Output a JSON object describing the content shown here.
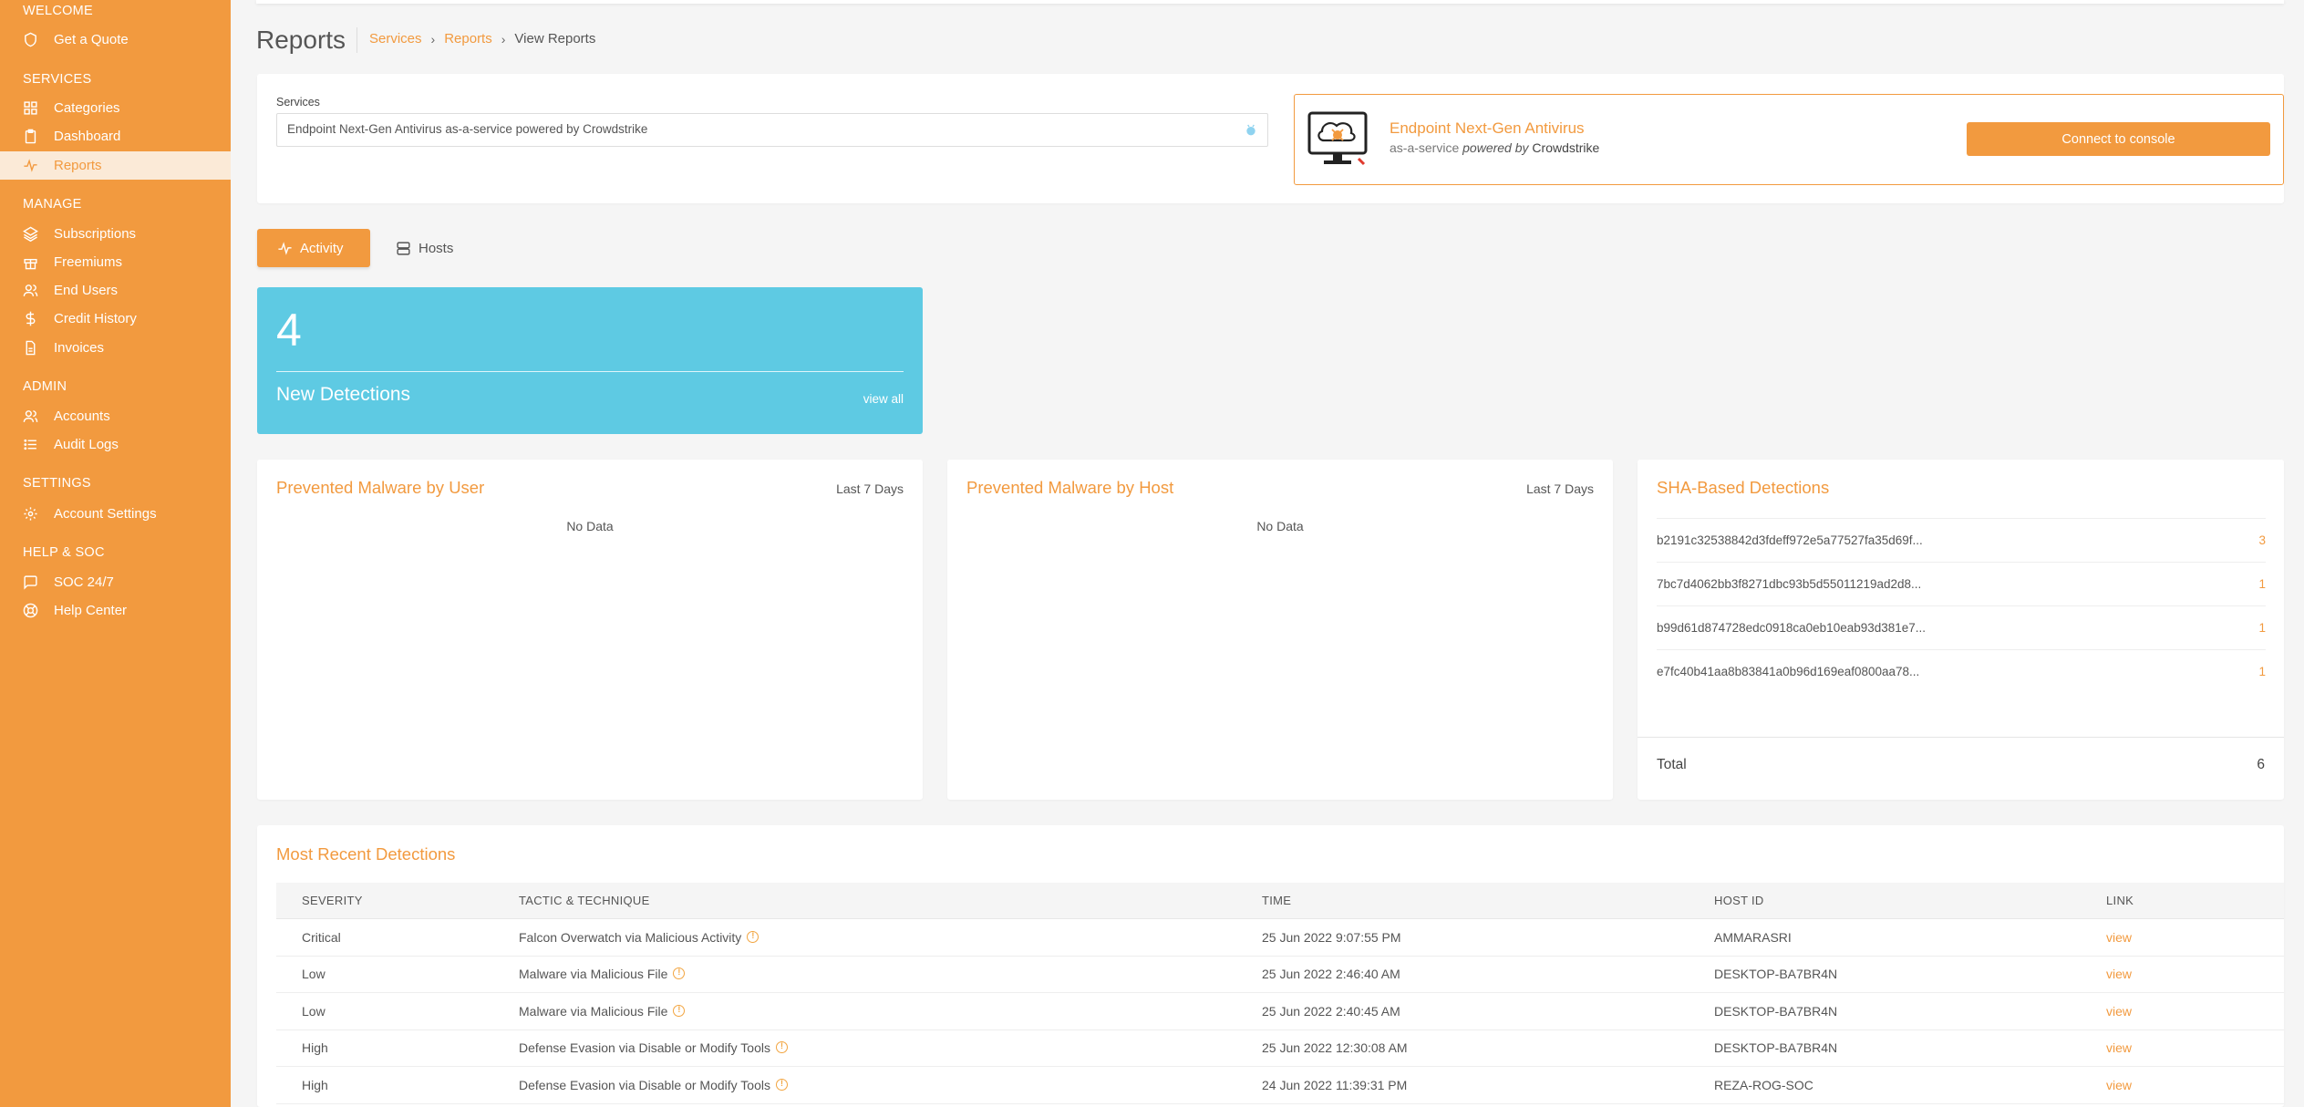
{
  "sidebar": {
    "sections": {
      "welcome": "WELCOME",
      "services": "SERVICES",
      "manage": "MANAGE",
      "admin": "ADMIN",
      "settings": "SETTINGS",
      "help": "HELP & SOC"
    },
    "items": {
      "get_quote": "Get a Quote",
      "categories": "Categories",
      "dashboard": "Dashboard",
      "reports": "Reports",
      "subscriptions": "Subscriptions",
      "freemiums": "Freemiums",
      "end_users": "End Users",
      "credit_history": "Credit History",
      "invoices": "Invoices",
      "accounts": "Accounts",
      "audit_logs": "Audit Logs",
      "account_settings": "Account Settings",
      "soc": "SOC 24/7",
      "help_center": "Help Center"
    }
  },
  "header": {
    "title": "Reports",
    "breadcrumb": [
      "Services",
      "Reports",
      "View Reports"
    ]
  },
  "services": {
    "label": "Services",
    "selected": "Endpoint Next-Gen Antivirus as-a-service powered by Crowdstrike"
  },
  "product": {
    "title": "Endpoint Next-Gen Antivirus",
    "sub_prefix": "as-a-service",
    "sub_powered": "powered by",
    "sub_vendor": "Crowdstrike",
    "connect_label": "Connect to console"
  },
  "tabs": {
    "activity": "Activity",
    "hosts": "Hosts"
  },
  "detections": {
    "count": "4",
    "label": "New Detections",
    "link": "view all"
  },
  "malware_user": {
    "title": "Prevented Malware by User",
    "range": "Last 7 Days",
    "empty": "No Data"
  },
  "malware_host": {
    "title": "Prevented Malware by Host",
    "range": "Last 7 Days",
    "empty": "No Data"
  },
  "sha": {
    "title": "SHA-Based Detections",
    "rows": [
      {
        "hash": "b2191c32538842d3fdeff972e5a77527fa35d69f...",
        "count": "3"
      },
      {
        "hash": "7bc7d4062bb3f8271dbc93b5d55011219ad2d8...",
        "count": "1"
      },
      {
        "hash": "b99d61d874728edc0918ca0eb10eab93d381e7...",
        "count": "1"
      },
      {
        "hash": "e7fc40b41aa8b83841a0b96d169eaf0800aa78...",
        "count": "1"
      }
    ],
    "total_label": "Total",
    "total_value": "6"
  },
  "recent": {
    "title": "Most Recent Detections",
    "columns": [
      "SEVERITY",
      "TACTIC & TECHNIQUE",
      "TIME",
      "HOST ID",
      "LINK"
    ],
    "rows": [
      {
        "severity": "Critical",
        "tactic": "Falcon Overwatch via Malicious Activity",
        "time": "25 Jun 2022 9:07:55 PM",
        "host": "AMMARASRI",
        "link": "view"
      },
      {
        "severity": "Low",
        "tactic": "Malware via Malicious File",
        "time": "25 Jun 2022 2:46:40 AM",
        "host": "DESKTOP-BA7BR4N",
        "link": "view"
      },
      {
        "severity": "Low",
        "tactic": "Malware via Malicious File",
        "time": "25 Jun 2022 2:40:45 AM",
        "host": "DESKTOP-BA7BR4N",
        "link": "view"
      },
      {
        "severity": "High",
        "tactic": "Defense Evasion via Disable or Modify Tools",
        "time": "25 Jun 2022 12:30:08 AM",
        "host": "DESKTOP-BA7BR4N",
        "link": "view"
      },
      {
        "severity": "High",
        "tactic": "Defense Evasion via Disable or Modify Tools",
        "time": "24 Jun 2022 11:39:31 PM",
        "host": "REZA-ROG-SOC",
        "link": "view"
      }
    ]
  },
  "colors": {
    "brand": "#f29a3f",
    "detections_card": "#5ecae3",
    "sidebar_active_bg": "#fbead7"
  }
}
